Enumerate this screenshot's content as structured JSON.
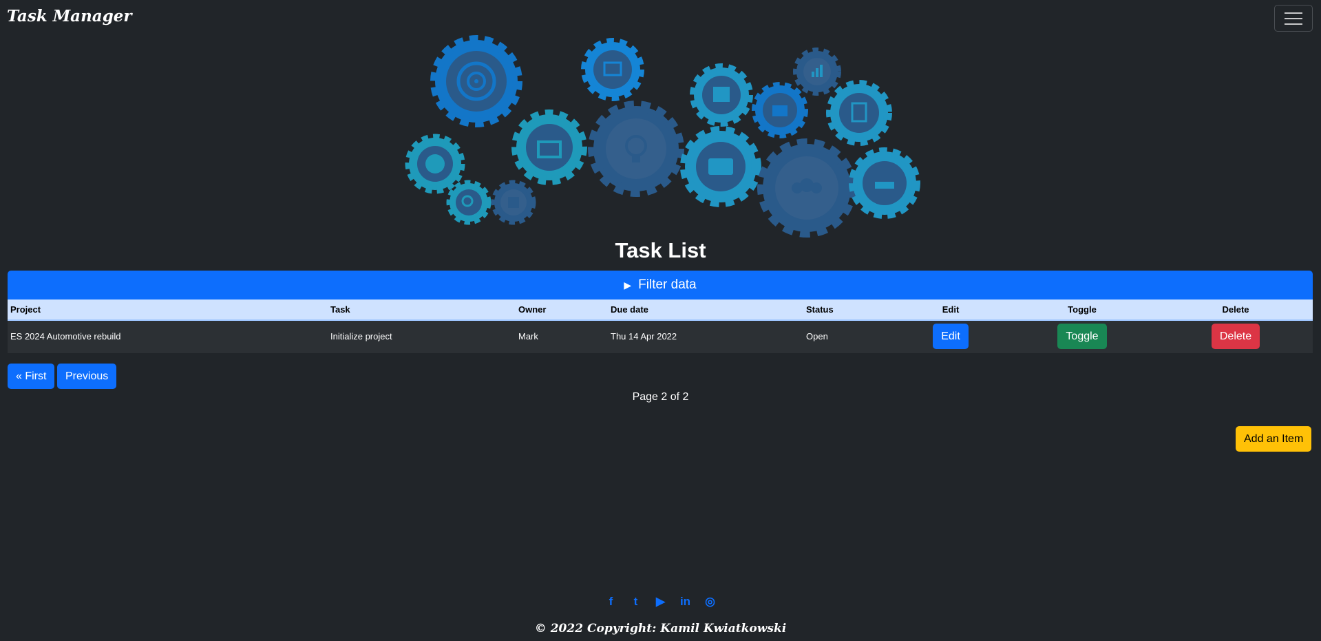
{
  "nav": {
    "brand": "Task Manager",
    "menu_icon": "hamburger-menu-icon"
  },
  "hero": {
    "icon": "gears-infographic"
  },
  "page_title": "Task List",
  "filter": {
    "label": "Filter data",
    "icon": "triangle-right-icon"
  },
  "table": {
    "headers": [
      "Project",
      "Task",
      "Owner",
      "Due date",
      "Status",
      "Edit",
      "Toggle",
      "Delete"
    ],
    "rows": [
      {
        "project": "ES 2024 Automotive rebuild",
        "task": "Initialize project",
        "owner": "Mark",
        "due": "Thu 14 Apr 2022",
        "status": "Open",
        "edit": "Edit",
        "toggle": "Toggle",
        "delete": "Delete"
      }
    ]
  },
  "pager": {
    "first": "« First",
    "previous": "Previous",
    "info": "Page 2 of 2"
  },
  "add_item": "Add an Item",
  "social": {
    "facebook": "f",
    "twitter": "t",
    "youtube": "▶",
    "linkedin": "in",
    "dribbble": "◎"
  },
  "footer": {
    "copyright": "© 2022 Copyright: Kamil Kwiatkowski"
  },
  "colors": {
    "background": "#212529",
    "primary": "#0d6efd",
    "success": "#198754",
    "danger": "#dc3545",
    "warning": "#ffc107",
    "table_header": "#cfe2ff"
  }
}
